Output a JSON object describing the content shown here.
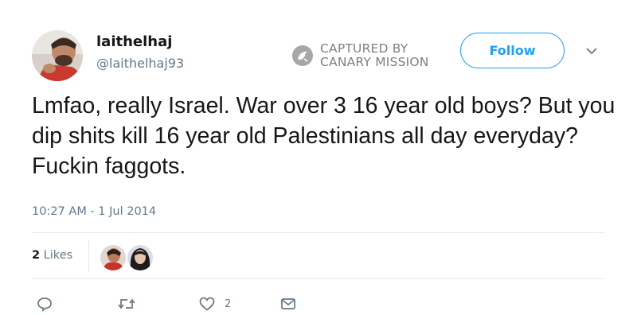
{
  "tweet": {
    "display_name": "laithelhaj",
    "handle": "@laithelhaj93",
    "text": "Lmfao, really Israel. War over 3 16 year old boys? But you dip shits kill 16 year old Palestinians all day everyday? Fuckin faggots.",
    "timestamp": "10:27 AM - 1 Jul 2014",
    "likes_count": "2",
    "likes_label": "Likes"
  },
  "header": {
    "follow_label": "Follow",
    "menu_icon": "chevron-down-icon"
  },
  "watermark": {
    "line1": "CAPTURED BY",
    "line2": "CANARY MISSION"
  },
  "actions": {
    "reply_icon": "reply-icon",
    "retweet_icon": "retweet-icon",
    "like_icon": "heart-icon",
    "like_count": "2",
    "message_icon": "envelope-icon"
  },
  "colors": {
    "accent": "#1da1f2",
    "secondary_text": "#657786",
    "divider": "#e6ecf0"
  }
}
